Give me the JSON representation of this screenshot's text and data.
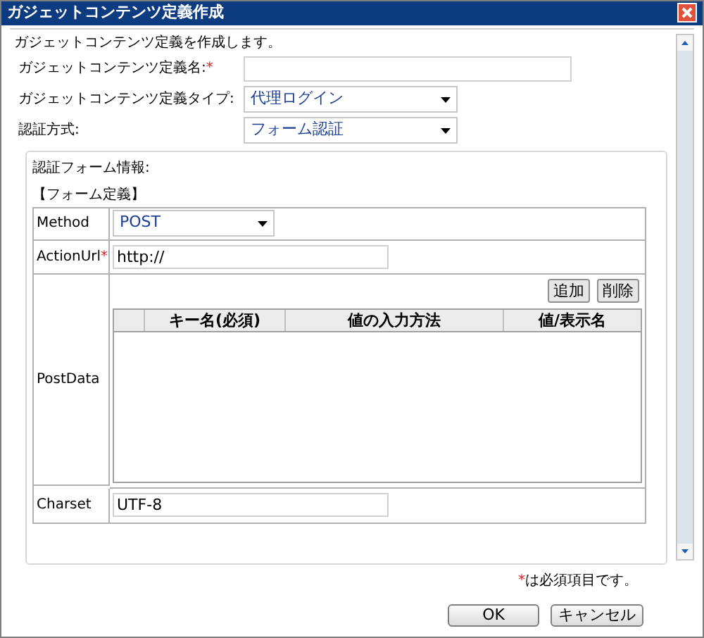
{
  "window": {
    "title": "ガジェットコンテンツ定義作成"
  },
  "intro": "ガジェットコンテンツ定義を作成します。",
  "fields": [
    {
      "kind": "text",
      "label": "ガジェットコンテンツ定義名:",
      "required_mark": "*"
    },
    {
      "kind": "select",
      "label": "ガジェットコンテンツ定義タイプ:",
      "value": "代理ログイン"
    },
    {
      "kind": "select",
      "label": "認証方式:",
      "value": "フォーム認証"
    }
  ],
  "auth_panel": {
    "title": "認証フォーム情報:",
    "section": "【フォーム定義】",
    "method": {
      "label": "Method",
      "value": "POST"
    },
    "action_url": {
      "label": "ActionUrl",
      "required_mark": "*",
      "value": "http://"
    },
    "post_data": {
      "label": "PostData",
      "buttons": [
        "追加",
        "削除"
      ],
      "columns": [
        "キー名(必須)",
        "値の入力方法",
        "値/表示名"
      ]
    },
    "charset": {
      "label": "Charset",
      "value": "UTF-8"
    }
  },
  "required_note": {
    "mark": "*",
    "text": "は必須項目です。"
  },
  "buttons": [
    "OK",
    "キャンセル"
  ]
}
